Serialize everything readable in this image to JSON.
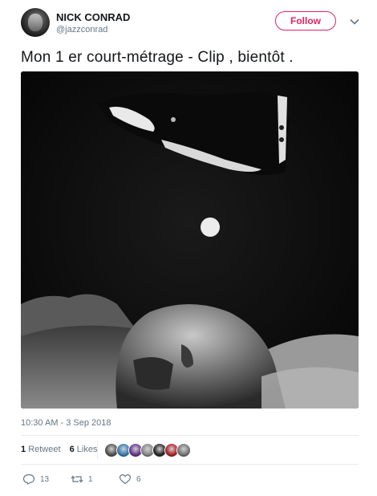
{
  "user": {
    "name": "NICK CONRAD",
    "handle": "@jazzconrad",
    "follow_label": "Follow"
  },
  "tweet": {
    "text": "Mon 1 er court-métrage - Clip , bientôt .",
    "timestamp": "10:30 AM - 3 Sep 2018"
  },
  "stats": {
    "retweets_count": "1",
    "retweets_label": "Retweet",
    "likes_count": "6",
    "likes_label": "Likes"
  },
  "likers": [
    {
      "icon": "avatar-1",
      "color": "#555555"
    },
    {
      "icon": "avatar-2",
      "color": "#3b7fb6"
    },
    {
      "icon": "avatar-3",
      "color": "#6a3a8e"
    },
    {
      "icon": "avatar-4",
      "color": "#8a8a8a"
    },
    {
      "icon": "avatar-5",
      "color": "#2a2a2a"
    },
    {
      "icon": "avatar-6",
      "color": "#b3262b"
    },
    {
      "icon": "avatar-7",
      "color": "#777777"
    }
  ],
  "actions": {
    "replies": "13",
    "retweets": "1",
    "likes": "6"
  },
  "colors": {
    "accent": "#e0245e",
    "muted": "#657786",
    "divider": "#e6ecf0"
  }
}
